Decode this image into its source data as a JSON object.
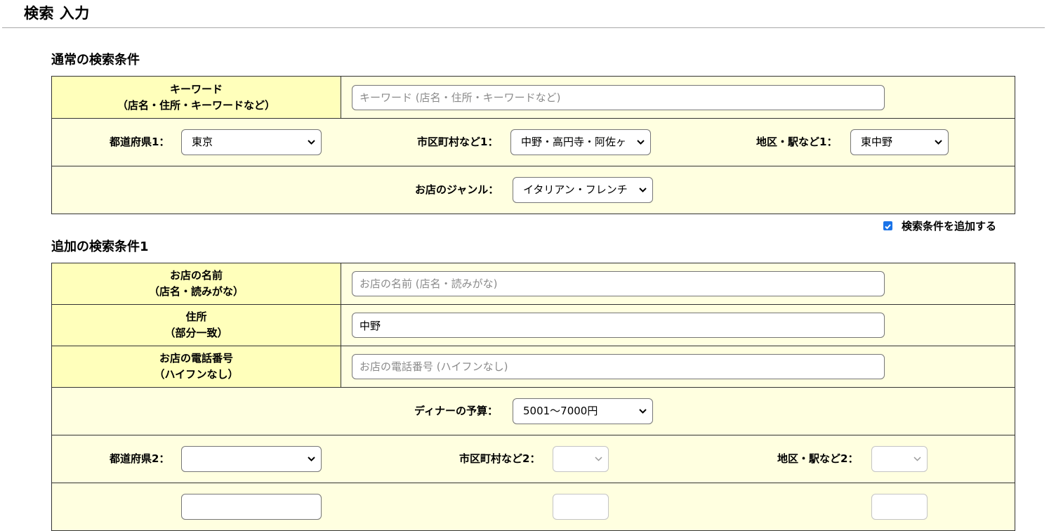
{
  "page": {
    "title": "検索 入力"
  },
  "normal_section": {
    "title": "通常の検索条件",
    "keyword": {
      "label_line1": "キーワード",
      "label_line2": "（店名・住所・キーワードなど）",
      "placeholder": "キーワード (店名・住所・キーワードなど)",
      "value": ""
    },
    "prefecture1": {
      "label": "都道府県1：",
      "value": "東京"
    },
    "city1": {
      "label": "市区町村など1：",
      "value": "中野・高円寺・阿佐ヶ"
    },
    "district1": {
      "label": "地区・駅など1：",
      "value": "東中野"
    },
    "genre": {
      "label": "お店のジャンル：",
      "value": "イタリアン・フレンチ"
    }
  },
  "add_condition": {
    "label": "検索条件を追加する",
    "checked": true
  },
  "additional_section": {
    "title": "追加の検索条件1",
    "shop_name": {
      "label_line1": "お店の名前",
      "label_line2": "（店名・読みがな）",
      "placeholder": "お店の名前 (店名・読みがな)",
      "value": ""
    },
    "address": {
      "label_line1": "住所",
      "label_line2": "（部分一致）",
      "placeholder": "",
      "value": "中野"
    },
    "phone": {
      "label_line1": "お店の電話番号",
      "label_line2": "（ハイフンなし）",
      "placeholder": "お店の電話番号 (ハイフンなし)",
      "value": ""
    },
    "dinner_budget": {
      "label": "ディナーの予算：",
      "value": "5001〜7000円"
    },
    "prefecture2": {
      "label": "都道府県2：",
      "value": ""
    },
    "city2": {
      "label": "市区町村など2：",
      "value": ""
    },
    "district2": {
      "label": "地区・駅など2：",
      "value": ""
    }
  },
  "colors": {
    "label_bg": "#ffffbb",
    "row_bg": "#ffffe0",
    "border": "#333333",
    "checkbox": "#1a73e8"
  }
}
